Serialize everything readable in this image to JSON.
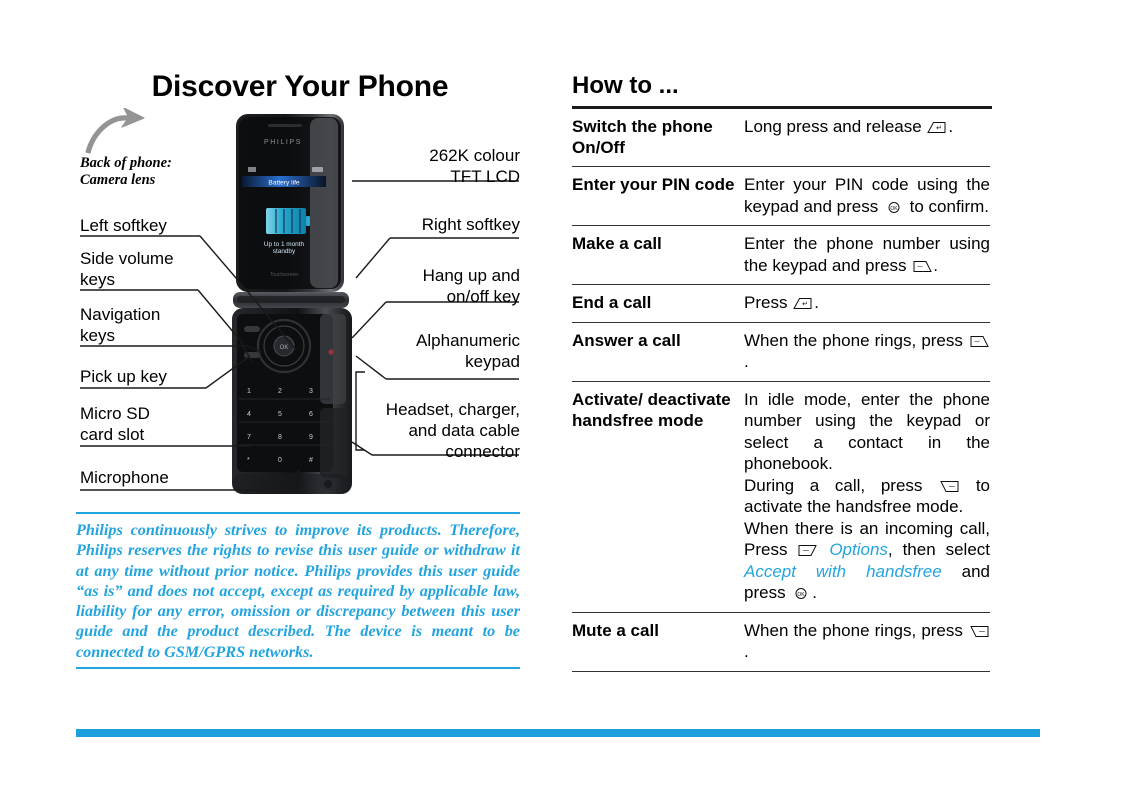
{
  "left": {
    "title": "Discover Your Phone",
    "back_caption_line1": "Back of phone:",
    "back_caption_line2": "Camera lens",
    "labels_left": [
      {
        "text": "Left softkey"
      },
      {
        "text": "Side volume"
      },
      {
        "text": "keys"
      },
      {
        "text": "Navigation"
      },
      {
        "text": "keys"
      },
      {
        "text": "Pick up key"
      },
      {
        "text": "Micro SD"
      },
      {
        "text": "card slot"
      },
      {
        "text": "Microphone"
      }
    ],
    "labels_right": [
      {
        "text": "262K colour"
      },
      {
        "text": "TFT LCD"
      },
      {
        "text": "Right softkey"
      },
      {
        "text": "Hang up and"
      },
      {
        "text": "on/off key"
      },
      {
        "text": "Alphanumeric"
      },
      {
        "text": "keypad"
      },
      {
        "text": "Headset, charger,"
      },
      {
        "text": "and data cable"
      },
      {
        "text": "connector"
      }
    ],
    "phone": {
      "brand": "PHILIPS",
      "screen_title": "Battery life",
      "screen_sub1": "Up to 1 month",
      "screen_sub2": "standby",
      "keys": [
        "1",
        "2",
        "3",
        "4",
        "5",
        "6",
        "7",
        "8",
        "9",
        "*",
        "0",
        "#"
      ]
    },
    "disclaimer": "Philips continuously strives to improve its products. Therefore, Philips reserves the rights to revise this user guide or withdraw it at any time without prior notice. Philips provides this user guide “as is” and does not accept, except as required by applicable law, liability for any error, omission or discrepancy between this user guide and the product described. The device is meant to be connected to GSM/GPRS networks."
  },
  "right": {
    "title": "How to ...",
    "rows": [
      {
        "key": "Switch the phone On/Off",
        "value_parts": [
          {
            "t": "text",
            "v": "Long press and release "
          },
          {
            "t": "icon",
            "v": "hangup-key-icon"
          },
          {
            "t": "text",
            "v": "."
          }
        ]
      },
      {
        "key": "Enter your PIN code",
        "value_parts": [
          {
            "t": "text",
            "v": "Enter your PIN code using the keypad and press "
          },
          {
            "t": "icon",
            "v": "ok-key-icon"
          },
          {
            "t": "text",
            "v": " to confirm."
          }
        ]
      },
      {
        "key": "Make a call",
        "value_parts": [
          {
            "t": "text",
            "v": "Enter the phone number using the keypad and press "
          },
          {
            "t": "icon",
            "v": "pickup-key-icon"
          },
          {
            "t": "text",
            "v": "."
          }
        ]
      },
      {
        "key": "End a call",
        "value_parts": [
          {
            "t": "text",
            "v": "Press "
          },
          {
            "t": "icon",
            "v": "hangup-key-icon"
          },
          {
            "t": "text",
            "v": "."
          }
        ]
      },
      {
        "key": "Answer a call",
        "value_parts": [
          {
            "t": "text",
            "v": "When the phone rings, press "
          },
          {
            "t": "icon",
            "v": "pickup-key-icon"
          },
          {
            "t": "text",
            "v": "."
          }
        ]
      },
      {
        "key": "Activate/ deactivate handsfree mode",
        "value_parts": [
          {
            "t": "text",
            "v": "In idle mode, enter the phone number using the keypad or select a contact in the phonebook."
          },
          {
            "t": "break",
            "v": ""
          },
          {
            "t": "text",
            "v": "During a call, press "
          },
          {
            "t": "icon",
            "v": "right-softkey-icon"
          },
          {
            "t": "text",
            "v": " to activate the handsfree mode."
          },
          {
            "t": "break",
            "v": ""
          },
          {
            "t": "text",
            "v": "When there is an incoming call, Press "
          },
          {
            "t": "icon",
            "v": "left-softkey-icon"
          },
          {
            "t": "cyan",
            "v": " Options"
          },
          {
            "t": "text",
            "v": ", then select "
          },
          {
            "t": "cyan",
            "v": "Accept with handsfree"
          },
          {
            "t": "text",
            "v": " and press "
          },
          {
            "t": "icon",
            "v": "ok-key-icon"
          },
          {
            "t": "text",
            "v": "."
          }
        ]
      },
      {
        "key": "Mute a call",
        "value_parts": [
          {
            "t": "text",
            "v": "When the phone rings, press "
          },
          {
            "t": "icon",
            "v": "right-softkey-icon"
          },
          {
            "t": "text",
            "v": "."
          }
        ]
      }
    ]
  },
  "colors": {
    "brand_blue": "#23A4DE",
    "bar_blue": "#1BA0DC",
    "rule_black": "#1a1a1a"
  }
}
